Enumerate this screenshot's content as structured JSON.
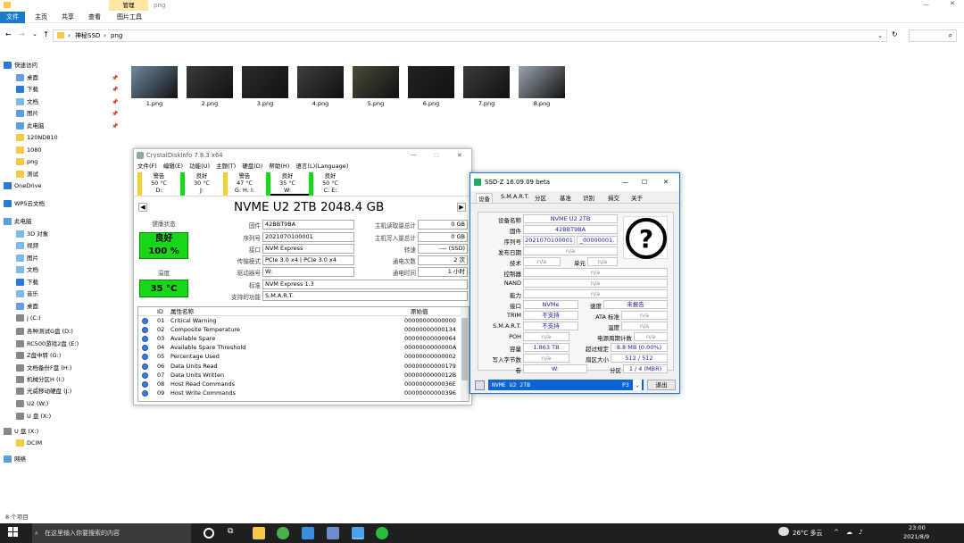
{
  "explorer": {
    "ribbon_tabs": [
      "文件",
      "主页",
      "共享",
      "查看",
      "图片工具"
    ],
    "manage_tab": "管理",
    "window_title": "png",
    "breadcrumb": [
      "神秘SSD",
      "png"
    ],
    "nav": [
      {
        "label": "快速访问",
        "pinned": false
      },
      {
        "label": "桌面",
        "pinned": true
      },
      {
        "label": "下载",
        "pinned": true
      },
      {
        "label": "文档",
        "pinned": true
      },
      {
        "label": "图片",
        "pinned": true
      },
      {
        "label": "此电脑",
        "pinned": true
      },
      {
        "label": "120ND810",
        "pinned": false
      },
      {
        "label": "1080",
        "pinned": false
      },
      {
        "label": "png",
        "pinned": false
      },
      {
        "label": "测试",
        "pinned": false
      },
      {
        "label": "OneDrive",
        "pinned": false
      },
      {
        "label": "WPS云文档",
        "pinned": false
      },
      {
        "label": "此电脑",
        "pinned": false
      },
      {
        "label": "3D 对象",
        "pinned": false
      },
      {
        "label": "视频",
        "pinned": false
      },
      {
        "label": "图片",
        "pinned": false
      },
      {
        "label": "文档",
        "pinned": false
      },
      {
        "label": "下载",
        "pinned": false
      },
      {
        "label": "音乐",
        "pinned": false
      },
      {
        "label": "桌面",
        "pinned": false
      },
      {
        "label": "j (C:)",
        "pinned": false
      },
      {
        "label": "各种测试G盘 (D:)",
        "pinned": false
      },
      {
        "label": "RC500游戏2盘 (E:)",
        "pinned": false
      },
      {
        "label": "Z盘中转 (G:)",
        "pinned": false
      },
      {
        "label": "文档备份F盘 (H:)",
        "pinned": false
      },
      {
        "label": "机械分区H (I:)",
        "pinned": false
      },
      {
        "label": "光威移动硬盘 (J:)",
        "pinned": false
      },
      {
        "label": "U2 (W:)",
        "pinned": false
      },
      {
        "label": "U 盘 (X:)",
        "pinned": false
      },
      {
        "label": "U 盘 (X:)",
        "pinned": false
      },
      {
        "label": "DCIM",
        "pinned": false
      },
      {
        "label": "网络",
        "pinned": false
      }
    ],
    "files": [
      "1.png",
      "2.png",
      "3.png",
      "4.png",
      "5.png",
      "6.png",
      "7.png",
      "8.png"
    ],
    "status": "8 个项目"
  },
  "cdi": {
    "title": "CrystalDiskInfo 7.8.3 x64",
    "menu": [
      "文件(F)",
      "编辑(E)",
      "功能(U)",
      "主题(T)",
      "硬盘(D)",
      "帮助(H)",
      "语言(L)(Language)"
    ],
    "drives": [
      {
        "state": "警告",
        "temp": "50 °C",
        "letter": "D:",
        "color": "#f2d230"
      },
      {
        "state": "良好",
        "temp": "30 °C",
        "letter": "J:",
        "color": "#18d618"
      },
      {
        "state": "警告",
        "temp": "47 °C",
        "letter": "G: H: I:",
        "color": "#f2d230"
      },
      {
        "state": "良好",
        "temp": "35 °C",
        "letter": "W:",
        "color": "#18d618"
      },
      {
        "state": "良好",
        "temp": "50 °C",
        "letter": "C: E:",
        "color": "#18d618"
      }
    ],
    "model": "NVME U2 2TB 2048.4 GB",
    "health_label": "健康状态",
    "health_state": "良好",
    "health_pct": "100 %",
    "temp_label": "温度",
    "temp_value": "35 °C",
    "left_labels": [
      "固件",
      "序列号",
      "接口",
      "传输模式",
      "驱动器号",
      "标准",
      "支持的功能"
    ],
    "left_values": [
      "42BBT9BA",
      "2021070100001",
      "NVM Express",
      "PCIe 3.0 x4 | PCIe 3.0 x4",
      "W:",
      "NVM Express 1.3",
      "S.M.A.R.T."
    ],
    "right_labels": [
      "主机读取量总计",
      "主机写入量总计",
      "转速",
      "通电次数",
      "通电时间"
    ],
    "right_values": [
      "0 GB",
      "0 GB",
      "---- (SSD)",
      "2 次",
      "1 小时"
    ],
    "smart_header": {
      "id": "ID",
      "name": "属性名称",
      "raw": "原始值"
    },
    "smart_rows": [
      {
        "id": "01",
        "name": "Critical Warning",
        "raw": "00000000000000"
      },
      {
        "id": "02",
        "name": "Composite Temperature",
        "raw": "00000000000134"
      },
      {
        "id": "03",
        "name": "Available Spare",
        "raw": "00000000000064"
      },
      {
        "id": "04",
        "name": "Available Spare Threshold",
        "raw": "0000000000000A"
      },
      {
        "id": "05",
        "name": "Percentage Used",
        "raw": "00000000000002"
      },
      {
        "id": "06",
        "name": "Data Units Read",
        "raw": "00000000000179"
      },
      {
        "id": "07",
        "name": "Data Units Written",
        "raw": "0000000000012B"
      },
      {
        "id": "08",
        "name": "Host Read Commands",
        "raw": "0000000000036E"
      },
      {
        "id": "09",
        "name": "Host Write Commands",
        "raw": "00000000000396"
      }
    ]
  },
  "ssdz": {
    "title": "SSD-Z 16.09.09 beta",
    "tabs": [
      "设备",
      "S.M.A.R.T.",
      "分区",
      "基准",
      "识别",
      "捐交",
      "关于"
    ],
    "rows": {
      "name_l": "设备名称",
      "name_v": "NVME U2 2TB",
      "fw_l": "固件",
      "fw_v": "42BBT9BA",
      "sn_l": "序列号",
      "sn_v1": "2021070100001",
      "sn_v2": "_00000001.",
      "date_l": "发布日期",
      "date_v": "n/a",
      "tech_l": "技术",
      "tech_v": "n/a",
      "cell_l": "单元",
      "cell_v": "n/a",
      "ctrl_l": "控制器",
      "ctrl_v": "n/a",
      "nand_l": "NAND",
      "nand_v": "n/a",
      "cap_l": "能力",
      "cap_v": "n/a",
      "if_l": "接口",
      "if_v": "NVMe",
      "speed_l": "速度",
      "speed_v": "未报告",
      "trim_l": "TRIM",
      "trim_v": "不支持",
      "ata_l": "ATA 标准",
      "ata_v": "n/a",
      "smart_l": "S.M.A.R.T.",
      "smart_v": "不支持",
      "temp_l": "温度",
      "temp_v": "n/a",
      "poh_l": "POH",
      "poh_v": "n/a",
      "pc_l": "电源周期计数",
      "pc_v": "n/a",
      "capy_l": "容量",
      "capy_v": "1.863 TB",
      "op_l": "超过规定",
      "op_v": "8.8 MB (0.00%)",
      "wb_l": "写入字节数",
      "wb_v": "n/a",
      "sector_l": "扇区大小",
      "sector_v": "512 / 512",
      "vol_l": "卷",
      "vol_v": "W:",
      "part_l": "分区",
      "part_v": "1 / 4 (MBR)"
    },
    "drive_select": "NVME U2 2TB",
    "drive_select_tag": "P3",
    "exit": "退出"
  },
  "taskbar": {
    "search_placeholder": "在这里输入你要搜索的内容",
    "weather": "26°C 多云",
    "time": "23:00",
    "date": "2021/8/9"
  }
}
